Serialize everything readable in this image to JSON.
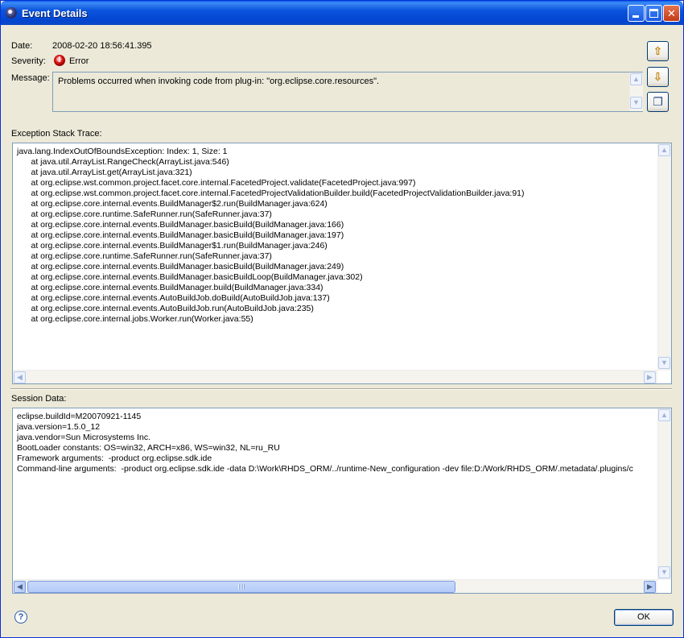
{
  "window": {
    "title": "Event Details"
  },
  "details": {
    "date_label": "Date:",
    "date_value": "2008-02-20 18:56:41.395",
    "severity_label": "Severity:",
    "severity_value": "Error",
    "message_label": "Message:",
    "message_value": "Problems occurred when invoking code from plug-in: \"org.eclipse.core.resources\"."
  },
  "exception": {
    "label": "Exception Stack Trace:",
    "lines": [
      "java.lang.IndexOutOfBoundsException: Index: 1, Size: 1",
      "      at java.util.ArrayList.RangeCheck(ArrayList.java:546)",
      "      at java.util.ArrayList.get(ArrayList.java:321)",
      "      at org.eclipse.wst.common.project.facet.core.internal.FacetedProject.validate(FacetedProject.java:997)",
      "      at org.eclipse.wst.common.project.facet.core.internal.FacetedProjectValidationBuilder.build(FacetedProjectValidationBuilder.java:91)",
      "      at org.eclipse.core.internal.events.BuildManager$2.run(BuildManager.java:624)",
      "      at org.eclipse.core.runtime.SafeRunner.run(SafeRunner.java:37)",
      "      at org.eclipse.core.internal.events.BuildManager.basicBuild(BuildManager.java:166)",
      "      at org.eclipse.core.internal.events.BuildManager.basicBuild(BuildManager.java:197)",
      "      at org.eclipse.core.internal.events.BuildManager$1.run(BuildManager.java:246)",
      "      at org.eclipse.core.runtime.SafeRunner.run(SafeRunner.java:37)",
      "      at org.eclipse.core.internal.events.BuildManager.basicBuild(BuildManager.java:249)",
      "      at org.eclipse.core.internal.events.BuildManager.basicBuildLoop(BuildManager.java:302)",
      "      at org.eclipse.core.internal.events.BuildManager.build(BuildManager.java:334)",
      "      at org.eclipse.core.internal.events.AutoBuildJob.doBuild(AutoBuildJob.java:137)",
      "      at org.eclipse.core.internal.events.AutoBuildJob.run(AutoBuildJob.java:235)",
      "      at org.eclipse.core.internal.jobs.Worker.run(Worker.java:55)"
    ]
  },
  "session": {
    "label": "Session Data:",
    "lines": [
      "eclipse.buildId=M20070921-1145",
      "java.version=1.5.0_12",
      "java.vendor=Sun Microsystems Inc.",
      "BootLoader constants: OS=win32, ARCH=x86, WS=win32, NL=ru_RU",
      "Framework arguments:  -product org.eclipse.sdk.ide",
      "Command-line arguments:  -product org.eclipse.sdk.ide -data D:\\Work\\RHDS_ORM/../runtime-New_configuration -dev file:D:/Work/RHDS_ORM/.metadata/.plugins/c"
    ]
  },
  "buttons": {
    "ok_label": "OK",
    "help_glyph": "?"
  },
  "icons": {
    "app": "eclipse-icon",
    "severity": "error-icon",
    "previous": "arrow-up-icon",
    "next": "arrow-down-icon",
    "copy": "copy-icon",
    "help": "help-icon"
  },
  "colors": {
    "title_bar": "#0a54dd",
    "dialog_bg": "#ece9d8",
    "error_red": "#e62020",
    "arrow_gold": "#e8a800"
  }
}
